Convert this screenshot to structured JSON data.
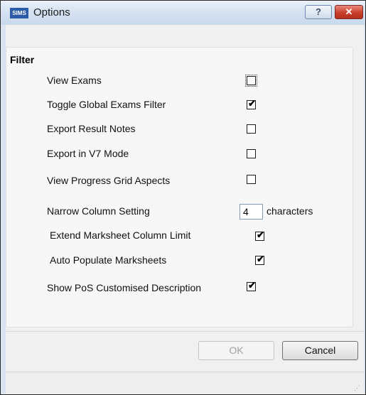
{
  "window": {
    "title": "Options",
    "app_icon_text": "SIMS",
    "help_label": "?",
    "close_label": "✕"
  },
  "filter": {
    "title": "Filter",
    "options": [
      {
        "label": "View Exams",
        "checked": false
      },
      {
        "label": "Toggle Global Exams Filter",
        "checked": true
      },
      {
        "label": "Export Result Notes",
        "checked": false
      },
      {
        "label": "Export in V7 Mode",
        "checked": false
      },
      {
        "label": "View Progress Grid Aspects",
        "checked": false
      },
      {
        "label": "Narrow Column Setting",
        "value": "4",
        "suffix": "characters"
      },
      {
        "label": "Extend Marksheet Column Limit",
        "checked": true
      },
      {
        "label": "Auto Populate Marksheets",
        "checked": true
      },
      {
        "label": "Show PoS Customised Description",
        "checked": true
      }
    ]
  },
  "buttons": {
    "ok": "OK",
    "cancel": "Cancel"
  },
  "check_glyph": "✔"
}
